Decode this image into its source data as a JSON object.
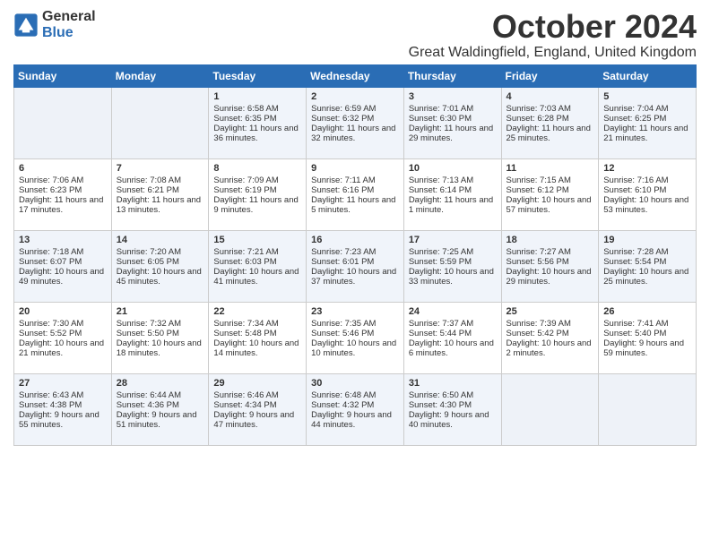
{
  "header": {
    "logo_general": "General",
    "logo_blue": "Blue",
    "month_title": "October 2024",
    "location": "Great Waldingfield, England, United Kingdom"
  },
  "days_of_week": [
    "Sunday",
    "Monday",
    "Tuesday",
    "Wednesday",
    "Thursday",
    "Friday",
    "Saturday"
  ],
  "weeks": [
    [
      {
        "day": "",
        "content": ""
      },
      {
        "day": "",
        "content": ""
      },
      {
        "day": "1",
        "content": "Sunrise: 6:58 AM\nSunset: 6:35 PM\nDaylight: 11 hours and 36 minutes."
      },
      {
        "day": "2",
        "content": "Sunrise: 6:59 AM\nSunset: 6:32 PM\nDaylight: 11 hours and 32 minutes."
      },
      {
        "day": "3",
        "content": "Sunrise: 7:01 AM\nSunset: 6:30 PM\nDaylight: 11 hours and 29 minutes."
      },
      {
        "day": "4",
        "content": "Sunrise: 7:03 AM\nSunset: 6:28 PM\nDaylight: 11 hours and 25 minutes."
      },
      {
        "day": "5",
        "content": "Sunrise: 7:04 AM\nSunset: 6:25 PM\nDaylight: 11 hours and 21 minutes."
      }
    ],
    [
      {
        "day": "6",
        "content": "Sunrise: 7:06 AM\nSunset: 6:23 PM\nDaylight: 11 hours and 17 minutes."
      },
      {
        "day": "7",
        "content": "Sunrise: 7:08 AM\nSunset: 6:21 PM\nDaylight: 11 hours and 13 minutes."
      },
      {
        "day": "8",
        "content": "Sunrise: 7:09 AM\nSunset: 6:19 PM\nDaylight: 11 hours and 9 minutes."
      },
      {
        "day": "9",
        "content": "Sunrise: 7:11 AM\nSunset: 6:16 PM\nDaylight: 11 hours and 5 minutes."
      },
      {
        "day": "10",
        "content": "Sunrise: 7:13 AM\nSunset: 6:14 PM\nDaylight: 11 hours and 1 minute."
      },
      {
        "day": "11",
        "content": "Sunrise: 7:15 AM\nSunset: 6:12 PM\nDaylight: 10 hours and 57 minutes."
      },
      {
        "day": "12",
        "content": "Sunrise: 7:16 AM\nSunset: 6:10 PM\nDaylight: 10 hours and 53 minutes."
      }
    ],
    [
      {
        "day": "13",
        "content": "Sunrise: 7:18 AM\nSunset: 6:07 PM\nDaylight: 10 hours and 49 minutes."
      },
      {
        "day": "14",
        "content": "Sunrise: 7:20 AM\nSunset: 6:05 PM\nDaylight: 10 hours and 45 minutes."
      },
      {
        "day": "15",
        "content": "Sunrise: 7:21 AM\nSunset: 6:03 PM\nDaylight: 10 hours and 41 minutes."
      },
      {
        "day": "16",
        "content": "Sunrise: 7:23 AM\nSunset: 6:01 PM\nDaylight: 10 hours and 37 minutes."
      },
      {
        "day": "17",
        "content": "Sunrise: 7:25 AM\nSunset: 5:59 PM\nDaylight: 10 hours and 33 minutes."
      },
      {
        "day": "18",
        "content": "Sunrise: 7:27 AM\nSunset: 5:56 PM\nDaylight: 10 hours and 29 minutes."
      },
      {
        "day": "19",
        "content": "Sunrise: 7:28 AM\nSunset: 5:54 PM\nDaylight: 10 hours and 25 minutes."
      }
    ],
    [
      {
        "day": "20",
        "content": "Sunrise: 7:30 AM\nSunset: 5:52 PM\nDaylight: 10 hours and 21 minutes."
      },
      {
        "day": "21",
        "content": "Sunrise: 7:32 AM\nSunset: 5:50 PM\nDaylight: 10 hours and 18 minutes."
      },
      {
        "day": "22",
        "content": "Sunrise: 7:34 AM\nSunset: 5:48 PM\nDaylight: 10 hours and 14 minutes."
      },
      {
        "day": "23",
        "content": "Sunrise: 7:35 AM\nSunset: 5:46 PM\nDaylight: 10 hours and 10 minutes."
      },
      {
        "day": "24",
        "content": "Sunrise: 7:37 AM\nSunset: 5:44 PM\nDaylight: 10 hours and 6 minutes."
      },
      {
        "day": "25",
        "content": "Sunrise: 7:39 AM\nSunset: 5:42 PM\nDaylight: 10 hours and 2 minutes."
      },
      {
        "day": "26",
        "content": "Sunrise: 7:41 AM\nSunset: 5:40 PM\nDaylight: 9 hours and 59 minutes."
      }
    ],
    [
      {
        "day": "27",
        "content": "Sunrise: 6:43 AM\nSunset: 4:38 PM\nDaylight: 9 hours and 55 minutes."
      },
      {
        "day": "28",
        "content": "Sunrise: 6:44 AM\nSunset: 4:36 PM\nDaylight: 9 hours and 51 minutes."
      },
      {
        "day": "29",
        "content": "Sunrise: 6:46 AM\nSunset: 4:34 PM\nDaylight: 9 hours and 47 minutes."
      },
      {
        "day": "30",
        "content": "Sunrise: 6:48 AM\nSunset: 4:32 PM\nDaylight: 9 hours and 44 minutes."
      },
      {
        "day": "31",
        "content": "Sunrise: 6:50 AM\nSunset: 4:30 PM\nDaylight: 9 hours and 40 minutes."
      },
      {
        "day": "",
        "content": ""
      },
      {
        "day": "",
        "content": ""
      }
    ]
  ]
}
